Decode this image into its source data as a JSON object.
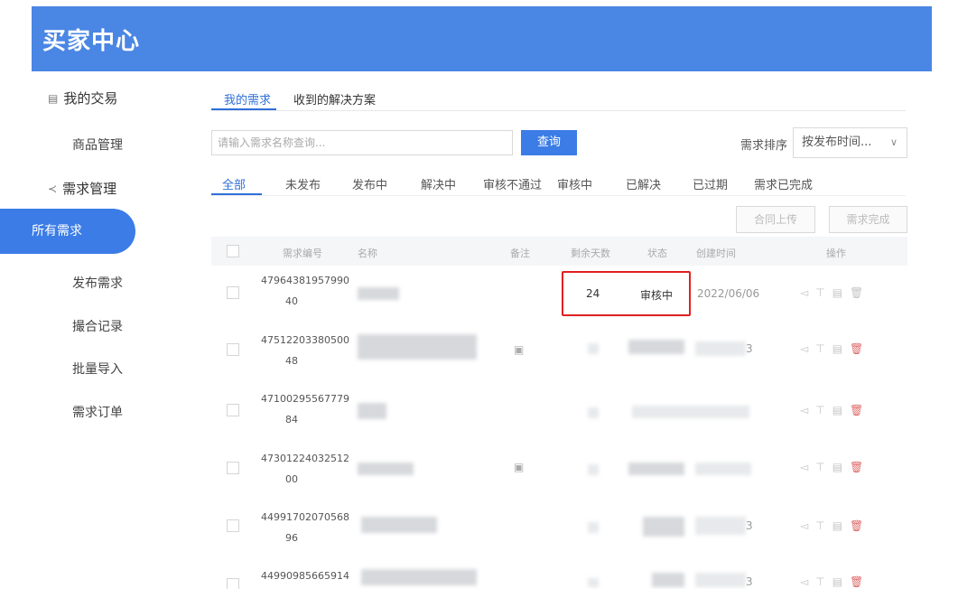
{
  "header": {
    "title": "买家中心"
  },
  "sidebar": {
    "group1": {
      "label": "我的交易"
    },
    "group1_items": [
      {
        "label": "商品管理"
      }
    ],
    "group2": {
      "label": "需求管理"
    },
    "group2_items": [
      {
        "label": "所有需求"
      },
      {
        "label": "发布需求"
      },
      {
        "label": "撮合记录"
      },
      {
        "label": "批量导入"
      },
      {
        "label": "需求订单"
      }
    ]
  },
  "tabs": [
    {
      "label": "我的需求"
    },
    {
      "label": "收到的解决方案"
    }
  ],
  "search": {
    "placeholder": "请输入需求名称查询...",
    "button": "查询"
  },
  "sort": {
    "label": "需求排序",
    "value": "按发布时间..."
  },
  "filters": [
    {
      "label": "全部"
    },
    {
      "label": "未发布"
    },
    {
      "label": "发布中"
    },
    {
      "label": "解决中"
    },
    {
      "label": "审核不通过"
    },
    {
      "label": "审核中"
    },
    {
      "label": "已解决"
    },
    {
      "label": "已过期"
    },
    {
      "label": "需求已完成"
    }
  ],
  "actions": {
    "upload": "合同上传",
    "complete": "需求完成"
  },
  "table": {
    "headers": {
      "id": "需求编号",
      "name": "名称",
      "note": "备注",
      "days": "剩余天数",
      "status": "状态",
      "created": "创建时间",
      "ops": "操作"
    },
    "rows": [
      {
        "id_line1": "47964381957990",
        "id_line2": "40",
        "days": "24",
        "status": "审核中",
        "created": "2022/06/06"
      },
      {
        "id_line1": "47512203380500",
        "id_line2": "48",
        "created_tail": "3"
      },
      {
        "id_line1": "47100295567779",
        "id_line2": "84"
      },
      {
        "id_line1": "47301224032512",
        "id_line2": "00"
      },
      {
        "id_line1": "44991702070568",
        "id_line2": "96",
        "created_tail": "3"
      },
      {
        "id_line1": "44990985665914",
        "id_line2": "",
        "created_tail": "3"
      }
    ]
  },
  "colors": {
    "header": "#4a86e4",
    "accent": "#2f6fd8",
    "highlight": "#e02020",
    "delete": "#e06a6a"
  },
  "icons": [
    "list-doc-icon",
    "share-icon",
    "send-icon",
    "pin-icon",
    "doc-icon",
    "trash-icon",
    "chevron-down-icon"
  ]
}
